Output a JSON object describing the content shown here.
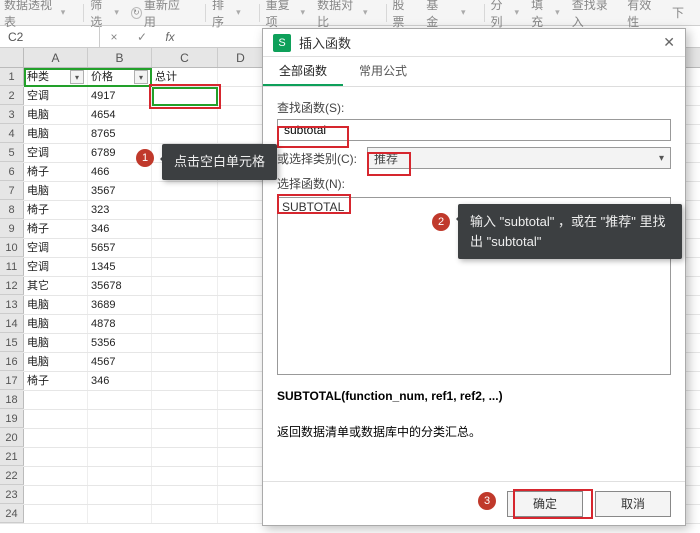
{
  "ribbon": {
    "pivot": "数据透视表",
    "filter": "筛选",
    "reapply": "重新应用",
    "sort": "排序",
    "remdup": "重复项",
    "datacomp": "数据对比",
    "stock": "股票",
    "fund": "基金",
    "split": "分列",
    "fill": "填充",
    "findinput": "查找录入",
    "valid": "有效性",
    "dropdown": "下"
  },
  "fx": {
    "namebox": "C2",
    "times": "×",
    "check": "✓",
    "fx": "fx"
  },
  "columns": [
    "A",
    "B",
    "C",
    "D"
  ],
  "headers": {
    "a": "种类",
    "b": "价格",
    "c": "总计"
  },
  "rows": [
    [
      "空调",
      "4917"
    ],
    [
      "电脑",
      "4654"
    ],
    [
      "电脑",
      "8765"
    ],
    [
      "空调",
      "6789"
    ],
    [
      "椅子",
      "466"
    ],
    [
      "电脑",
      "3567"
    ],
    [
      "椅子",
      "323"
    ],
    [
      "椅子",
      "346"
    ],
    [
      "空调",
      "5657"
    ],
    [
      "空调",
      "1345"
    ],
    [
      "其它",
      "35678"
    ],
    [
      "电脑",
      "3689"
    ],
    [
      "电脑",
      "4878"
    ],
    [
      "电脑",
      "5356"
    ],
    [
      "电脑",
      "4567"
    ],
    [
      "椅子",
      "346"
    ]
  ],
  "tips": {
    "t1": "点击空白单元格",
    "t2a": "输入 \"subtotal\" ，或在 \"推荐\" 里找",
    "t2b": "出 \"subtotal\""
  },
  "dialog": {
    "title": "插入函数",
    "tab1": "全部函数",
    "tab2": "常用公式",
    "search_label": "查找函数(S):",
    "search_value": "subtotal",
    "cat_label": "或选择类别(C):",
    "cat_value": "推荐",
    "sel_label": "选择函数(N):",
    "list_item": "SUBTOTAL",
    "sig": "SUBTOTAL(function_num, ref1, ref2, ...)",
    "desc": "返回数据清单或数据库中的分类汇总。",
    "ok": "确定",
    "cancel": "取消"
  }
}
